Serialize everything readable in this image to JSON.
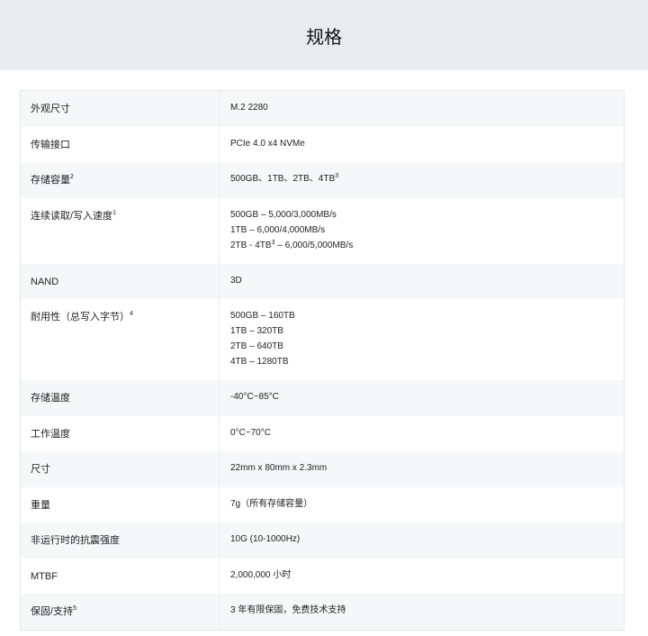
{
  "title": "规格",
  "rows": [
    {
      "label": "外观尺寸",
      "values": [
        "M.2 2280"
      ]
    },
    {
      "label": "传输接口",
      "values": [
        "PCIe 4.0 x4 NVMe"
      ]
    },
    {
      "label": "存储容量",
      "label_sup": "2",
      "values": [
        "500GB、1TB、2TB、4TB"
      ],
      "value_sup": "3"
    },
    {
      "label": "连续读取/写入速度",
      "label_sup": "1",
      "values": [
        "500GB – 5,000/3,000MB/s",
        "1TB – 6,000/4,000MB/s"
      ],
      "speed_last": {
        "pre": "2TB - 4TB",
        "sup": "3",
        "post": " – 6,000/5,000MB/s"
      }
    },
    {
      "label": "NAND",
      "values": [
        "3D"
      ]
    },
    {
      "label": "耐用性（总写入字节）",
      "label_sup": "4",
      "values": [
        "500GB – 160TB",
        "1TB – 320TB",
        "2TB – 640TB",
        "4TB – 1280TB"
      ]
    },
    {
      "label": "存储温度",
      "values": [
        "-40°C~85°C"
      ]
    },
    {
      "label": "工作温度",
      "values": [
        "0°C~70°C"
      ]
    },
    {
      "label": "尺寸",
      "values": [
        "22mm x 80mm x 2.3mm"
      ]
    },
    {
      "label": "重量",
      "values": [
        "7g（所有存储容量）"
      ]
    },
    {
      "label": "非运行时的抗震强度",
      "values": [
        "10G (10-1000Hz)"
      ]
    },
    {
      "label": "MTBF",
      "values": [
        "2,000,000 小时"
      ]
    },
    {
      "label": "保固/支持",
      "label_sup": "5",
      "values": [
        "3 年有限保固，免费技术支持"
      ]
    }
  ]
}
